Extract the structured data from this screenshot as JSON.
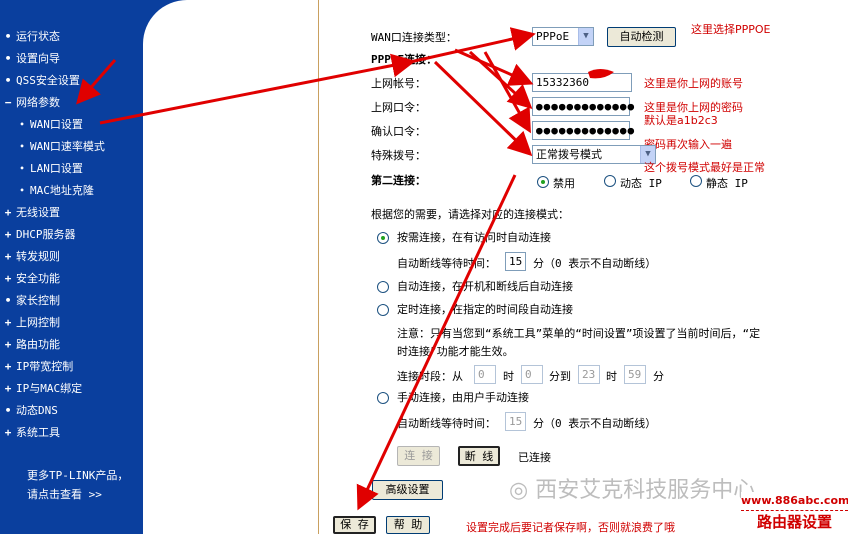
{
  "sidebar": {
    "items": [
      {
        "mark": "•",
        "label": "运行状态",
        "sub": false
      },
      {
        "mark": "•",
        "label": "设置向导",
        "sub": false
      },
      {
        "mark": "•",
        "label": "QSS安全设置",
        "sub": false
      },
      {
        "mark": "−",
        "label": "网络参数",
        "sub": false
      },
      {
        "mark": "•",
        "label": "WAN口设置",
        "sub": true
      },
      {
        "mark": "•",
        "label": "WAN口速率模式",
        "sub": true
      },
      {
        "mark": "•",
        "label": "LAN口设置",
        "sub": true
      },
      {
        "mark": "•",
        "label": "MAC地址克隆",
        "sub": true
      },
      {
        "mark": "+",
        "label": "无线设置",
        "sub": false
      },
      {
        "mark": "+",
        "label": "DHCP服务器",
        "sub": false
      },
      {
        "mark": "+",
        "label": "转发规则",
        "sub": false
      },
      {
        "mark": "+",
        "label": "安全功能",
        "sub": false
      },
      {
        "mark": "•",
        "label": "家长控制",
        "sub": false
      },
      {
        "mark": "+",
        "label": "上网控制",
        "sub": false
      },
      {
        "mark": "+",
        "label": "路由功能",
        "sub": false
      },
      {
        "mark": "+",
        "label": "IP带宽控制",
        "sub": false
      },
      {
        "mark": "+",
        "label": "IP与MAC绑定",
        "sub": false
      },
      {
        "mark": "•",
        "label": "动态DNS",
        "sub": false
      },
      {
        "mark": "+",
        "label": "系统工具",
        "sub": false
      }
    ],
    "promo_line1": "更多TP-LINK产品，",
    "promo_line2": "请点击查看 >>"
  },
  "form": {
    "wan_type_label": "WAN口连接类型：",
    "wan_type_value": "PPPoE",
    "auto_detect_label": "自动检测",
    "pppoe_heading": "PPPoE连接：",
    "account_label": "上网帐号：",
    "account_value": "15332360",
    "password_label": "上网口令：",
    "password_value": "●●●●●●●●●●●●●",
    "confirm_label": "确认口令：",
    "confirm_value": "●●●●●●●●●●●●●",
    "special_dial_label": "特殊拨号：",
    "special_dial_value": "正常拨号模式",
    "secondary_label": "第二连接：",
    "secondary_options": [
      "禁用",
      "动态 IP",
      "静态 IP"
    ],
    "mode_intro": "根据您的需要，请选择对应的连接模式：",
    "opt_on_demand": "按需连接，在有访问时自动连接",
    "idle_label": "自动断线等待时间：",
    "idle_value": "15",
    "idle_unit": "分（0 表示不自动断线）",
    "opt_auto": "自动连接，在开机和断线后自动连接",
    "opt_timed": "定时连接，在指定的时间段自动连接",
    "note_line1": "注意：只有当您到“系统工具”菜单的“时间设置”项设置了当前时间后，“定",
    "note_line2": "时连接”功能才能生效。",
    "period_label": "连接时段：从",
    "period_from_h": "0",
    "hour_label": "时",
    "period_from_m": "0",
    "min_to_label": "分到",
    "period_to_h": "23",
    "period_to_m": "59",
    "min_label": "分",
    "opt_manual": "手动连接，由用户手动连接",
    "idle_value2": "15",
    "connect_label": "连 接",
    "disconnect_label": "断 线",
    "status_text": "已连接",
    "advanced_label": "高级设置",
    "save_label": "保 存",
    "help_label": "帮 助"
  },
  "annotations": {
    "choose_pppoe": "这里选择PPPOE",
    "account_note": "这里是你上网的账号",
    "password_note1": "这里是你上网的密码",
    "password_note2": "默认是a1b2c3",
    "confirm_note": "密码再次输入一遍",
    "dial_note": "这个拨号模式最好是正常",
    "save_note": "设置完成后要记者保存啊，否则就浪费了哦"
  },
  "watermark": {
    "text": "西安艾克科技服务中心",
    "url": "www.886abc.com",
    "router_text": "路由器设置"
  },
  "colors": {
    "sidebar_bg": "#0a3f9e",
    "annotation_red": "#d00000"
  }
}
